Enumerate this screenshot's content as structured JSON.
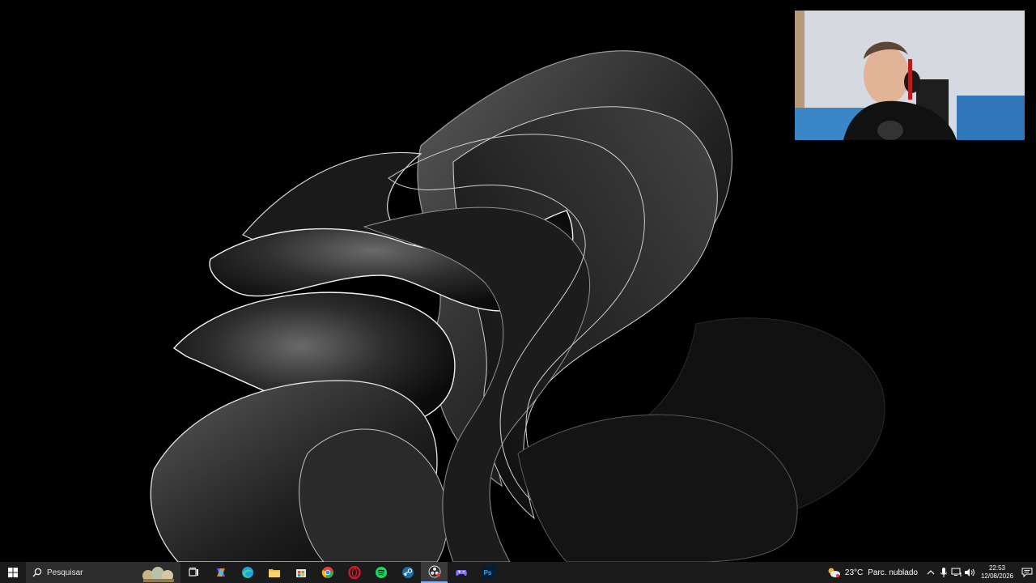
{
  "taskbar": {
    "search_placeholder": "Pesquisar",
    "apps": [
      {
        "name": "task-view-icon",
        "color": "#ffffff"
      },
      {
        "name": "copilot-icon",
        "color": "#6a5cff"
      },
      {
        "name": "edge-icon",
        "color": "#1fa3e0"
      },
      {
        "name": "file-explorer-icon",
        "color": "#f2c24b"
      },
      {
        "name": "store-icon",
        "color": "#1e90ff"
      },
      {
        "name": "chrome-icon",
        "color": "#e84335"
      },
      {
        "name": "opera-icon",
        "color": "#e0162b"
      },
      {
        "name": "spotify-icon",
        "color": "#1ed760"
      },
      {
        "name": "steam-icon",
        "color": "#1b6ea8"
      },
      {
        "name": "obs-icon",
        "color": "#2b2b2b"
      },
      {
        "name": "gamepad-icon",
        "color": "#8a6cff"
      },
      {
        "name": "photoshop-icon",
        "color": "#001e36",
        "label": "Ps"
      }
    ],
    "active_app": "obs-icon"
  },
  "tray": {
    "weather": {
      "temperature": "23°C",
      "condition": "Parc. nublado"
    },
    "time": "22:53",
    "date": "12/08/2026"
  }
}
